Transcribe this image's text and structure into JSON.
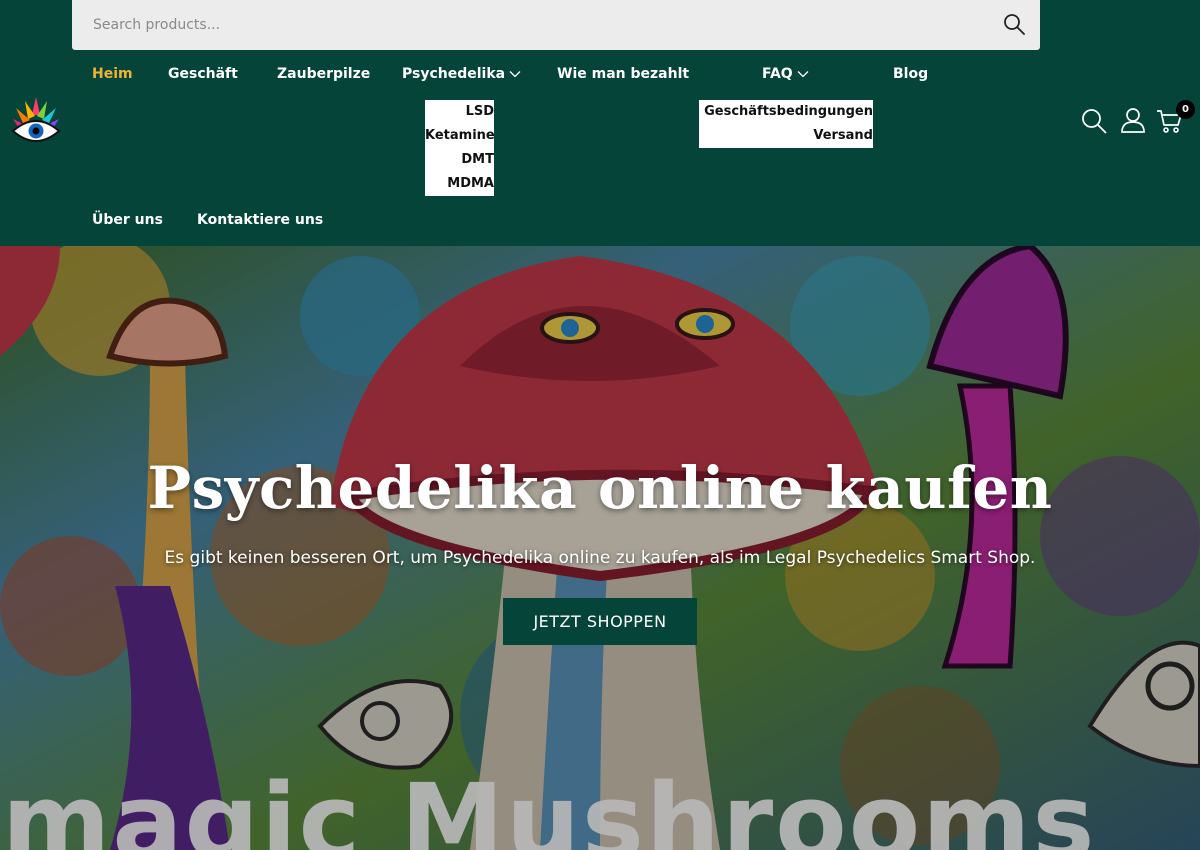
{
  "search": {
    "placeholder": "Search products..."
  },
  "nav": {
    "items": [
      {
        "label": "Heim"
      },
      {
        "label": "Geschäft"
      },
      {
        "label": "Zauberpilze"
      },
      {
        "label": "Psychedelika"
      },
      {
        "label": "Wie man bezahlt"
      },
      {
        "label": "FAQ"
      },
      {
        "label": "Blog"
      },
      {
        "label": "Über uns"
      },
      {
        "label": "Kontaktiere uns"
      }
    ],
    "active": "Heim",
    "psychedelika_submenu": [
      "LSD",
      "Ketamine",
      "DMT",
      "MDMA"
    ],
    "faq_submenu": [
      "Geschäftsbedingungen",
      "Versand"
    ]
  },
  "cart": {
    "count": "0"
  },
  "icons": {
    "search": "search-icon",
    "account": "user-icon",
    "cart": "cart-icon",
    "submenu": "chevron-down-icon",
    "logo": "eye-lotus-logo"
  },
  "hero": {
    "title": "Psychedelika online kaufen",
    "subtitle": "Es gibt keinen besseren Ort, um Psychedelika online zu kaufen, als im Legal Psychedelics Smart Shop.",
    "cta_label": "JETZT SHOPPEN",
    "watermark_text": "magic Mushrooms"
  },
  "colors": {
    "header_bg": "#044439",
    "accent_active": "#f0b336",
    "button_bg": "#044439",
    "search_bg": "#ececec"
  }
}
